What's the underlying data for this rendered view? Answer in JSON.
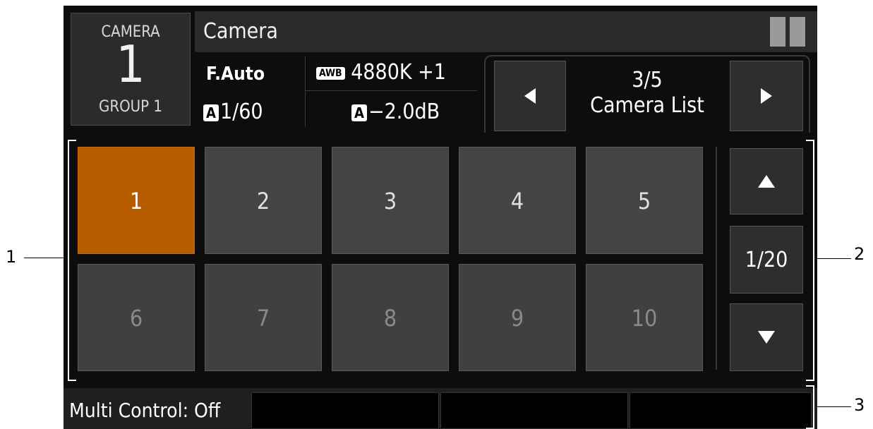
{
  "camera_box": {
    "top_label": "CAMERA",
    "number": "1",
    "group_label": "GROUP 1"
  },
  "title": "Camera",
  "info": {
    "focus": "F.Auto",
    "wb_badge": "AWB",
    "wb_value": "4880K +1",
    "shutter_badge": "A",
    "shutter": "1/60",
    "gain_badge": "A",
    "gain": "−2.0dB"
  },
  "page_nav": {
    "page": "3/5",
    "label": "Camera List"
  },
  "camera_grid": [
    {
      "label": "1",
      "state": "selected"
    },
    {
      "label": "2",
      "state": "normal"
    },
    {
      "label": "3",
      "state": "normal"
    },
    {
      "label": "4",
      "state": "normal"
    },
    {
      "label": "5",
      "state": "normal"
    },
    {
      "label": "6",
      "state": "dim"
    },
    {
      "label": "7",
      "state": "dim"
    },
    {
      "label": "8",
      "state": "dim"
    },
    {
      "label": "9",
      "state": "dim"
    },
    {
      "label": "10",
      "state": "dim"
    }
  ],
  "list_page": "1/20",
  "status": {
    "multi_control": "Multi Control: Off"
  },
  "callouts": {
    "c1": "1",
    "c2": "2",
    "c3": "3"
  },
  "colors": {
    "selected": "#b85c00",
    "button": "#444444",
    "background": "#0d0d0d"
  }
}
